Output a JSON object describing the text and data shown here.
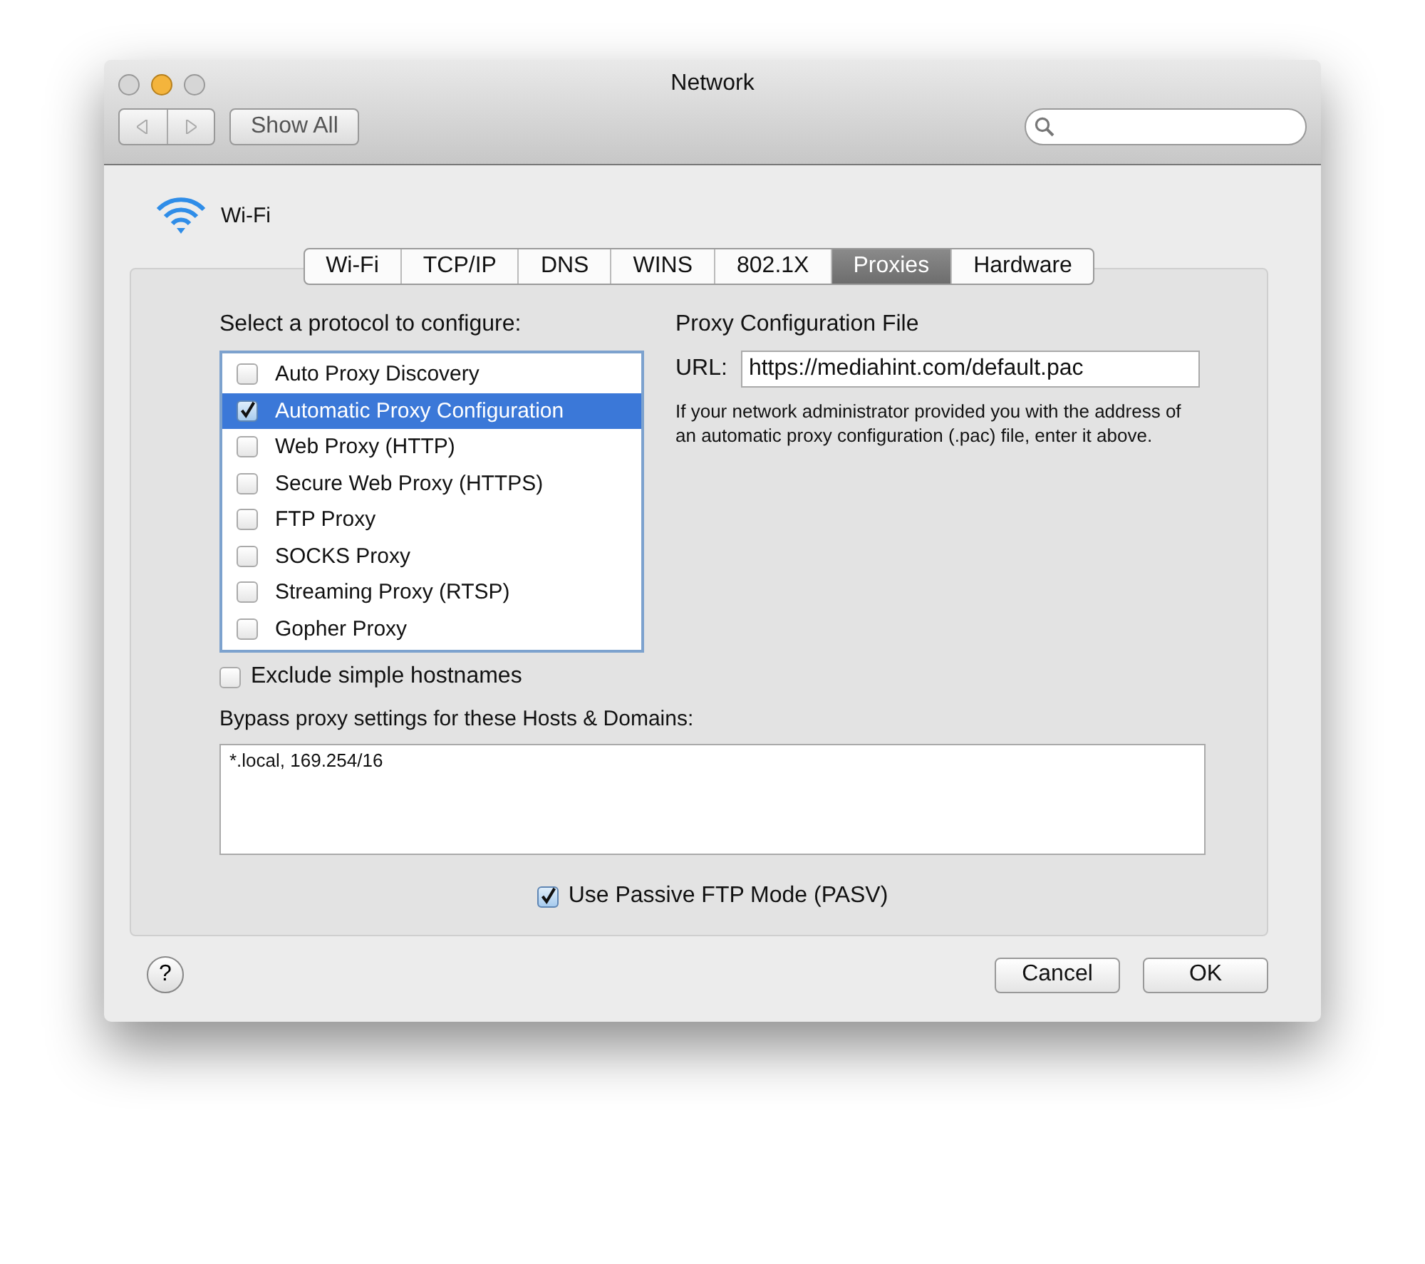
{
  "window": {
    "title": "Network"
  },
  "toolbar": {
    "show_all": "Show All"
  },
  "service": {
    "name": "Wi-Fi"
  },
  "tabs": [
    {
      "label": "Wi-Fi",
      "selected": false
    },
    {
      "label": "TCP/IP",
      "selected": false
    },
    {
      "label": "DNS",
      "selected": false
    },
    {
      "label": "WINS",
      "selected": false
    },
    {
      "label": "802.1X",
      "selected": false
    },
    {
      "label": "Proxies",
      "selected": true
    },
    {
      "label": "Hardware",
      "selected": false
    }
  ],
  "protocols": {
    "heading": "Select a protocol to configure:",
    "items": [
      {
        "label": "Auto Proxy Discovery",
        "checked": false,
        "selected": false
      },
      {
        "label": "Automatic Proxy Configuration",
        "checked": true,
        "selected": true
      },
      {
        "label": "Web Proxy (HTTP)",
        "checked": false,
        "selected": false
      },
      {
        "label": "Secure Web Proxy (HTTPS)",
        "checked": false,
        "selected": false
      },
      {
        "label": "FTP Proxy",
        "checked": false,
        "selected": false
      },
      {
        "label": "SOCKS Proxy",
        "checked": false,
        "selected": false
      },
      {
        "label": "Streaming Proxy (RTSP)",
        "checked": false,
        "selected": false
      },
      {
        "label": "Gopher Proxy",
        "checked": false,
        "selected": false
      }
    ]
  },
  "config_file": {
    "heading": "Proxy Configuration File",
    "url_label": "URL:",
    "url": "https://mediahint.com/default.pac",
    "note": "If your network administrator provided you with the address of an automatic proxy configuration (.pac) file, enter it above."
  },
  "exclude_simple": {
    "label": "Exclude simple hostnames",
    "checked": false
  },
  "bypass": {
    "label": "Bypass proxy settings for these Hosts & Domains:",
    "value": "*.local, 169.254/16"
  },
  "passive_ftp": {
    "label": "Use Passive FTP Mode (PASV)",
    "checked": true
  },
  "help": "?",
  "buttons": [
    "Cancel",
    "OK"
  ]
}
